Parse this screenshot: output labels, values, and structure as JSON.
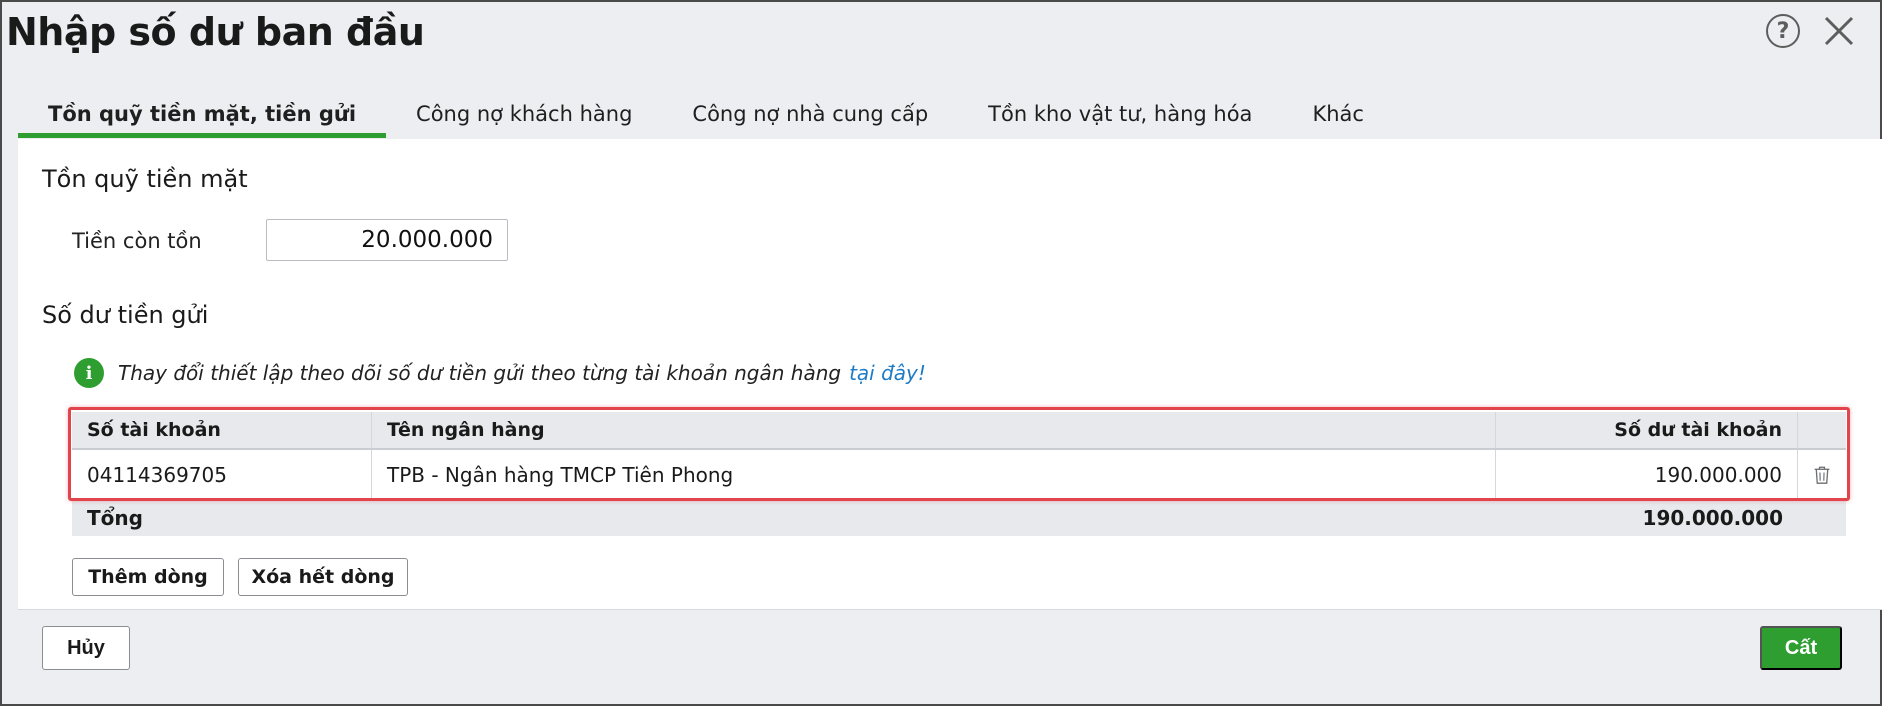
{
  "dialog": {
    "title": "Nhập số dư ban đầu",
    "help_label": "?"
  },
  "tabs": [
    {
      "label": "Tồn quỹ tiền mặt, tiền gửi",
      "active": true
    },
    {
      "label": "Công nợ khách hàng",
      "active": false
    },
    {
      "label": "Công nợ nhà cung cấp",
      "active": false
    },
    {
      "label": "Tồn kho vật tư, hàng hóa",
      "active": false
    },
    {
      "label": "Khác",
      "active": false
    }
  ],
  "cash": {
    "section_title": "Tồn quỹ tiền mặt",
    "field_label": "Tiền còn tồn",
    "field_value": "20.000.000"
  },
  "deposit": {
    "section_title": "Số dư tiền gửi",
    "info_text": "Thay đổi thiết lập theo dõi số dư tiền gửi theo từng tài khoản ngân hàng",
    "info_link": "tại đây!",
    "info_icon": "i",
    "columns": [
      "Số tài khoản",
      "Tên ngân hàng",
      "Số dư tài khoản"
    ],
    "rows": [
      {
        "account": "04114369705",
        "bank": "TPB - Ngân hàng TMCP Tiên Phong",
        "balance": "190.000.000"
      }
    ],
    "total_label": "Tổng",
    "total_value": "190.000.000",
    "add_row_label": "Thêm dòng",
    "clear_rows_label": "Xóa hết dòng"
  },
  "footer": {
    "cancel_label": "Hủy",
    "save_label": "Cất"
  },
  "colors": {
    "accent": "#2e9e31",
    "link": "#1e7bc4",
    "highlight": "#e1444a"
  }
}
